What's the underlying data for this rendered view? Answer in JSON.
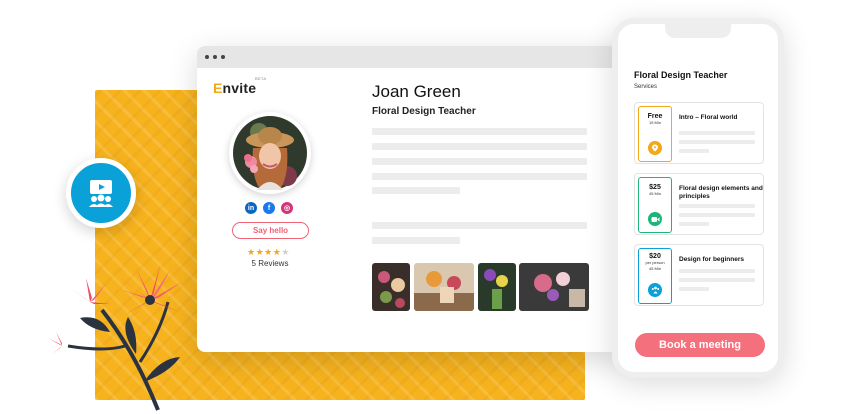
{
  "app": {
    "logo_text_rest": "nvite",
    "logo_letter": "E",
    "logo_badge": "BETA"
  },
  "profile": {
    "name": "Joan Green",
    "title": "Floral Design Teacher",
    "say_hello_label": "Say hello",
    "rating_stars": 4,
    "rating_max": 5,
    "reviews_label": "5 Reviews",
    "socials": [
      "linkedin-icon",
      "facebook-icon",
      "instagram-icon"
    ]
  },
  "phone": {
    "header_title": "Floral Design Teacher",
    "header_subtitle": "Services",
    "services": [
      {
        "price": "Free",
        "price_sub": "",
        "duration": "15 Min",
        "name": "Intro – Floral world",
        "color": "#f2a818",
        "icon": "location-pin-icon"
      },
      {
        "price": "$25",
        "price_sub": "",
        "duration": "45 Min",
        "name": "Floral design elements and principles",
        "color": "#1fb57a",
        "icon": "video-camera-icon"
      },
      {
        "price": "$20",
        "price_sub": "per person",
        "duration": "45 Min",
        "name": "Design for beginners",
        "color": "#0aa0d8",
        "icon": "group-icon"
      }
    ],
    "book_label": "Book a meeting"
  },
  "colors": {
    "accent_yellow": "#f7b31e",
    "accent_blue": "#0aa0d8",
    "accent_pink": "#f3707c"
  }
}
